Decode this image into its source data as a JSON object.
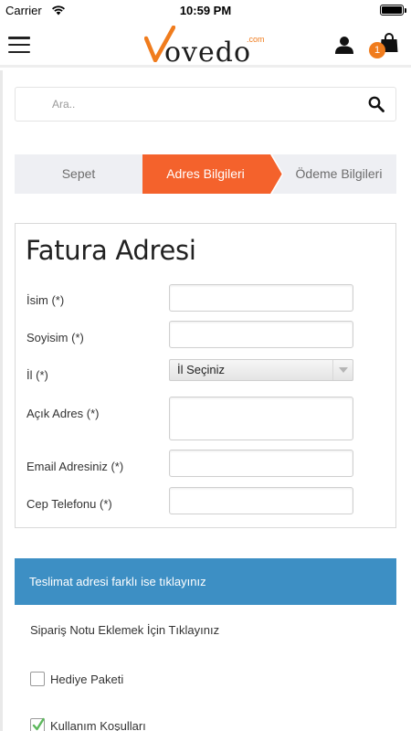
{
  "status_bar": {
    "carrier": "Carrier",
    "time": "10:59 PM"
  },
  "header": {
    "logo_text": "ovedo",
    "logo_suffix": ".com",
    "cart_count": "1",
    "brand_color": "#f07c1d"
  },
  "search": {
    "placeholder": "Ara.."
  },
  "steps": [
    {
      "label": "Sepet",
      "active": false
    },
    {
      "label": "Adres Bilgileri",
      "active": true
    },
    {
      "label": "Ödeme Bilgileri",
      "active": false
    }
  ],
  "billing": {
    "title": "Fatura Adresi",
    "fields": {
      "name": {
        "label": "İsim (*)",
        "value": ""
      },
      "surname": {
        "label": "Soyisim (*)",
        "value": ""
      },
      "city": {
        "label": "İl (*)",
        "selected": "İl Seçiniz"
      },
      "address": {
        "label": "Açık Adres (*)",
        "value": ""
      },
      "email": {
        "label": "Email Adresiniz (*)",
        "value": ""
      },
      "phone": {
        "label": "Cep Telefonu (*)",
        "value": ""
      }
    }
  },
  "shipping_toggle": "Teslimat adresi farklı ise tıklayınız",
  "order_note": "Sipariş Notu Eklemek İçin Tıklayınız",
  "checkboxes": {
    "gift": {
      "label": "Hediye Paketi",
      "checked": false
    },
    "terms": {
      "label": "Kullanım Koşulları",
      "checked": true
    }
  },
  "colors": {
    "active_step": "#f4622c",
    "shipping_bar": "#3d8fc4",
    "check": "#5cb85c"
  }
}
